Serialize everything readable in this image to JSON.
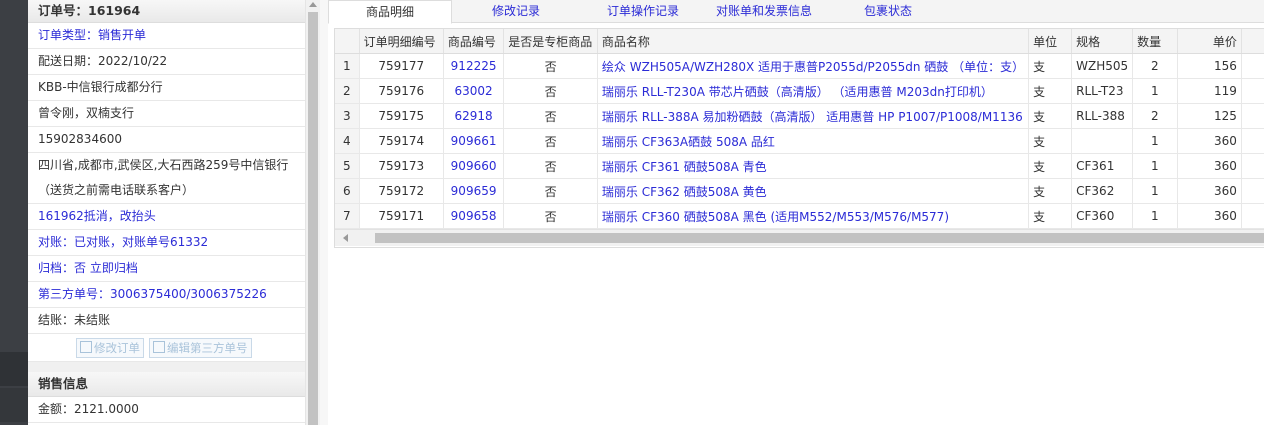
{
  "order": {
    "title": "订单号：161964",
    "rows": [
      {
        "text": "订单类型：销售开单",
        "style": "blue"
      },
      {
        "text": "配送日期：2022/10/22",
        "style": "normal"
      },
      {
        "text": "KBB-中信银行成都分行",
        "style": "normal"
      },
      {
        "text": "曾令刚，双楠支行",
        "style": "normal"
      },
      {
        "text": "15902834600",
        "style": "normal"
      }
    ],
    "address_line1": "四川省,成都市,武侯区,大石西路259号中信银行",
    "address_line2": "（送货之前需电话联系客户）",
    "rows2": [
      {
        "text": "161962抵消，改抬头",
        "style": "blue"
      },
      {
        "text": "对账：已对账，对账单号61332",
        "style": "blue"
      },
      {
        "text": "归档：否 立即归档",
        "style": "blue"
      },
      {
        "text": "第三方单号：3006375400/3006375226",
        "style": "blue"
      },
      {
        "text": "结账：未结账",
        "style": "normal"
      }
    ],
    "edit_order_btn": "修改订单",
    "edit_third_btn": "编辑第三方单号"
  },
  "sales": {
    "title": "销售信息",
    "amount": "金额：2121.0000"
  },
  "tabs": [
    "商品明细",
    "修改记录",
    "订单操作记录",
    "对账单和发票信息",
    "包裹状态"
  ],
  "table": {
    "headers": [
      "订单明细编号",
      "商品编号",
      "是否是专柜商品",
      "商品名称",
      "单位",
      "规格",
      "数量",
      "单价"
    ],
    "rows": [
      {
        "n": "1",
        "detail": "759177",
        "code": "912225",
        "counter": "否",
        "name": "绘众 WZH505A/WZH280X 适用于惠普P2055d/P2055dn 硒鼓 （单位：支）",
        "unit": "支",
        "spec": "WZH505",
        "qty": "2",
        "price": "156"
      },
      {
        "n": "2",
        "detail": "759176",
        "code": "63002",
        "counter": "否",
        "name": "瑞丽乐 RLL-T230A 带芯片硒鼓（高清版） （适用惠普 M203dn打印机）",
        "unit": "支",
        "spec": "RLL-T23",
        "qty": "1",
        "price": "119"
      },
      {
        "n": "3",
        "detail": "759175",
        "code": "62918",
        "counter": "否",
        "name": "瑞丽乐 RLL-388A 易加粉硒鼓（高清版） 适用惠普 HP P1007/P1008/M1136",
        "unit": "支",
        "spec": "RLL-388",
        "qty": "2",
        "price": "125"
      },
      {
        "n": "4",
        "detail": "759174",
        "code": "909661",
        "counter": "否",
        "name": "瑞丽乐 CF363A硒鼓 508A 品红",
        "unit": "支",
        "spec": "",
        "qty": "1",
        "price": "360"
      },
      {
        "n": "5",
        "detail": "759173",
        "code": "909660",
        "counter": "否",
        "name": "瑞丽乐 CF361 硒鼓508A 青色",
        "unit": "支",
        "spec": "CF361",
        "qty": "1",
        "price": "360"
      },
      {
        "n": "6",
        "detail": "759172",
        "code": "909659",
        "counter": "否",
        "name": "瑞丽乐 CF362 硒鼓508A 黄色",
        "unit": "支",
        "spec": "CF362",
        "qty": "1",
        "price": "360"
      },
      {
        "n": "7",
        "detail": "759171",
        "code": "909658",
        "counter": "否",
        "name": "瑞丽乐 CF360 硒鼓508A 黑色 (适用M552/M553/M576/M577)",
        "unit": "支",
        "spec": "CF360",
        "qty": "1",
        "price": "360"
      }
    ]
  },
  "colors": {
    "link": "#2b2bd6",
    "sidebar": "#3c3f44"
  }
}
